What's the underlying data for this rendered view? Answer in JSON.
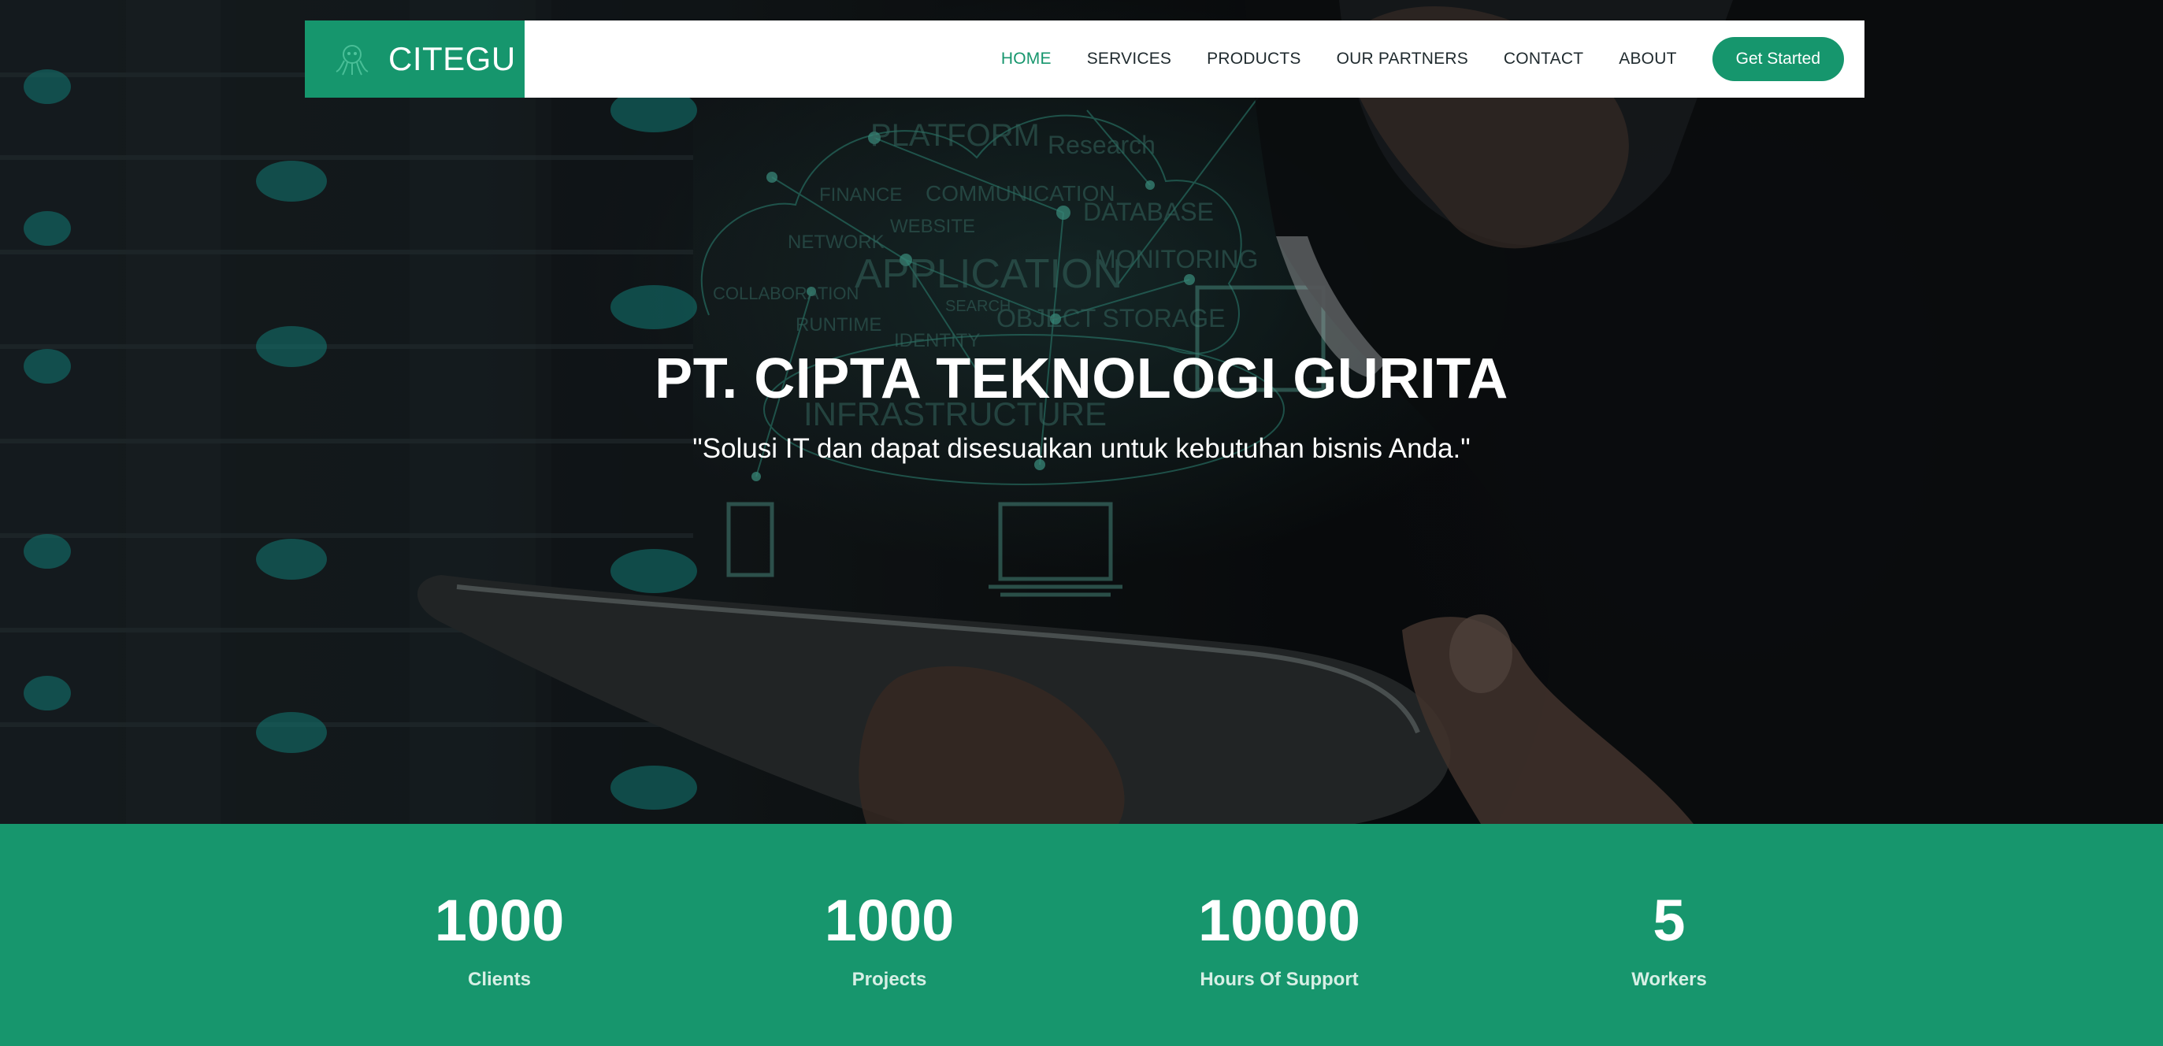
{
  "brand": {
    "name": "CITEGU",
    "color": "#16966d"
  },
  "nav": {
    "items": [
      {
        "label": "HOME",
        "active": true
      },
      {
        "label": "SERVICES",
        "active": false
      },
      {
        "label": "PRODUCTS",
        "active": false
      },
      {
        "label": "OUR PARTNERS",
        "active": false
      },
      {
        "label": "CONTACT",
        "active": false
      },
      {
        "label": "ABOUT",
        "active": false
      }
    ],
    "cta_label": "Get Started"
  },
  "hero": {
    "title": "PT. CIPTA TEKNOLOGI GURITA",
    "subtitle": "\"Solusi IT dan dapat disesuaikan untuk kebutuhan bisnis Anda.\"",
    "image_words": [
      "PLATFORM",
      "Research",
      "FINANCE",
      "COMMUNICATION",
      "NETWORK",
      "WEBSITE",
      "DATABASE",
      "APPLICATION",
      "MONITORING",
      "COLLABORATION",
      "SEARCH",
      "OBJECT STORAGE",
      "RUNTIME",
      "IDENTITY",
      "INFRASTRUCTURE"
    ]
  },
  "stats": [
    {
      "value": "1000",
      "label": "Clients"
    },
    {
      "value": "1000",
      "label": "Projects"
    },
    {
      "value": "10000",
      "label": "Hours Of Support"
    },
    {
      "value": "5",
      "label": "Workers"
    }
  ],
  "colors": {
    "accent": "#16966d",
    "nav_text": "#1f2a2e",
    "stat_label": "#d7efe5"
  },
  "icons": {
    "brand_logo": "octopus-logo-icon"
  }
}
